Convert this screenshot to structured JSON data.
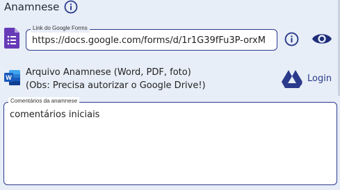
{
  "section": {
    "title": "Anamnese"
  },
  "link_field": {
    "label": "Link do Google Forms",
    "value": "https://docs.google.com/forms/d/1r1G39fFu3P-orxM"
  },
  "upload": {
    "line1": "Arquivo Anamnese (Word, PDF, foto)",
    "line2": "(Obs: Precisa autorizar o Google Drive!)",
    "login_label": "Login"
  },
  "comments": {
    "label": "Comentários da anamnese",
    "value": "comentários iniciais"
  },
  "icons": {
    "title_info": "info-icon",
    "forms": "google-forms-icon",
    "link_info": "info-icon",
    "eye": "eye-icon",
    "word": "word-icon",
    "drive": "google-drive-icon"
  },
  "colors": {
    "accent": "#2b3a8c",
    "forms_purple": "#673ab7",
    "word_blue": "#185abd",
    "background": "#e7eef7"
  }
}
